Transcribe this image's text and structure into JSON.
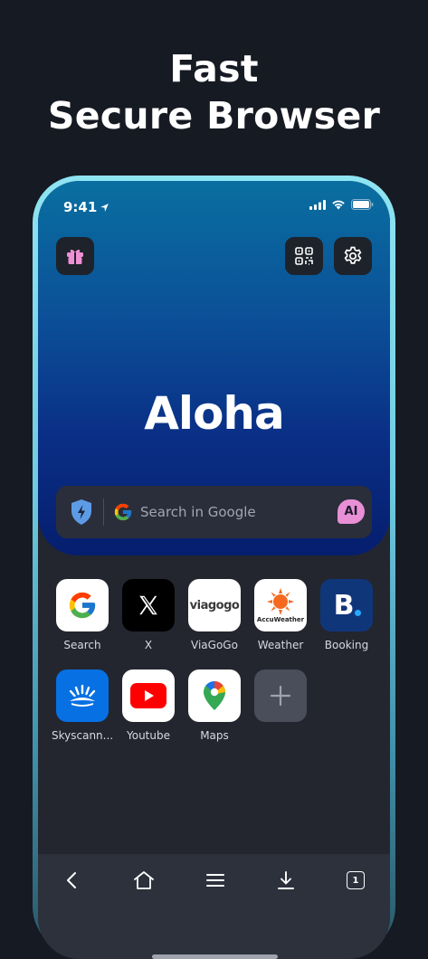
{
  "headline": {
    "line1": "Fast",
    "line2": "Secure Browser"
  },
  "status": {
    "time": "9:41"
  },
  "hero": {
    "logo": "Aloha"
  },
  "search": {
    "placeholder": "Search in Google",
    "ai_label": "AI"
  },
  "speed_dial": [
    {
      "label": "Search",
      "icon": "google-icon"
    },
    {
      "label": "X",
      "icon": "x-icon"
    },
    {
      "label": "ViaGoGo",
      "icon": "viagogo-icon",
      "logo_text": "viagogo"
    },
    {
      "label": "Weather",
      "icon": "accuweather-icon",
      "logo_text": "AccuWeather"
    },
    {
      "label": "Booking",
      "icon": "booking-icon",
      "logo_text": "B"
    },
    {
      "label": "Skyscann...",
      "icon": "skyscanner-icon"
    },
    {
      "label": "Youtube",
      "icon": "youtube-icon"
    },
    {
      "label": "Maps",
      "icon": "maps-icon"
    }
  ],
  "toolbar": {
    "tab_count": "1"
  },
  "colors": {
    "background": "#161a23",
    "accent_pink": "#e88fd6",
    "hero_top": "#0a6fa0",
    "hero_bottom": "#061e6e"
  }
}
